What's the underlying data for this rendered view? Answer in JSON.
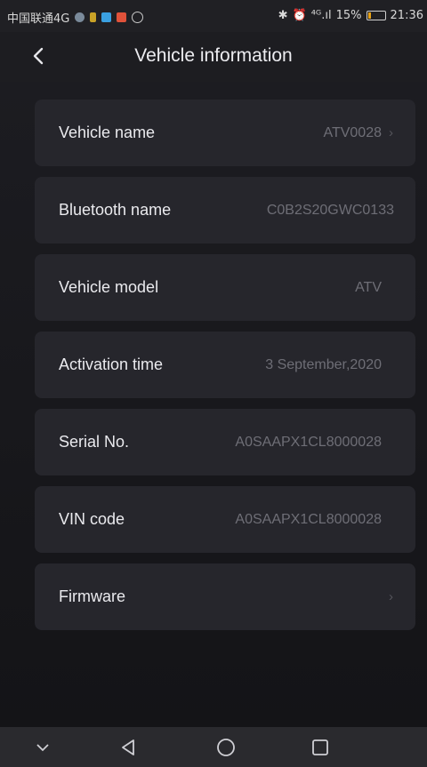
{
  "status": {
    "carrier": "中国联通4G",
    "signal": "⁴ᴳ.ıl",
    "battery": "15%",
    "battery_level": 0.15,
    "time": "21:36"
  },
  "header": {
    "back_icon": "chevron-left-icon",
    "title": "Vehicle information"
  },
  "rows": [
    {
      "label": "Vehicle name",
      "value": "ATV0028",
      "chevron": "›"
    },
    {
      "label": "Bluetooth name",
      "value": "C0B2S20GWC0133"
    },
    {
      "label": "Vehicle model",
      "value": "ATV"
    },
    {
      "label": "Activation time",
      "value": "3 September,2020"
    },
    {
      "label": "Serial No.",
      "value": "A0SAAPX1CL8000028"
    },
    {
      "label": "VIN code",
      "value": "A0SAAPX1CL8000028"
    },
    {
      "label": "Firmware",
      "value": "",
      "chevron": "›"
    }
  ],
  "colors": {
    "background": "#17171b",
    "card": "#26262c",
    "value_text": "#6e6e76"
  }
}
